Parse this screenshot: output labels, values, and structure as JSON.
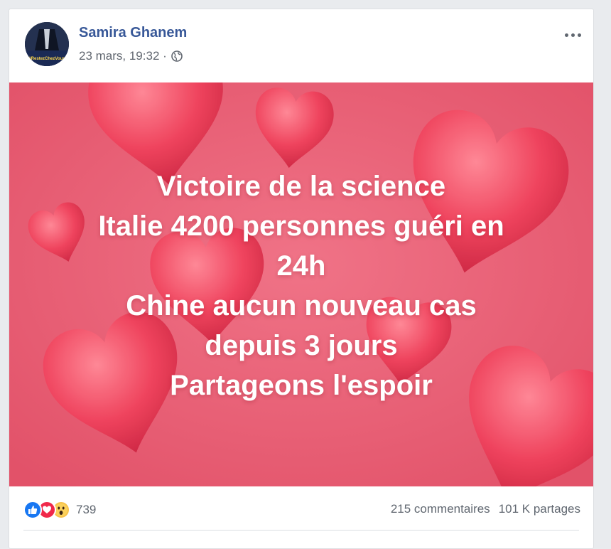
{
  "post": {
    "author": "Samira Ghanem",
    "timestamp": "23 mars, 19:32 ·",
    "privacy_icon": "globe-icon",
    "avatar_badge": "#RestezChezVous",
    "image_text_lines": [
      "Victoire de la science",
      "Italie 4200 personnes guéri en",
      "24h",
      "Chine aucun nouveau cas",
      "depuis 3 jours",
      "Partageons l'espoir"
    ],
    "image_background_color": "#ea6479",
    "reactions": {
      "icons": [
        "like-icon",
        "love-icon",
        "wow-icon"
      ],
      "count": "739"
    },
    "comments": "215 commentaires",
    "shares": "101 K partages"
  }
}
